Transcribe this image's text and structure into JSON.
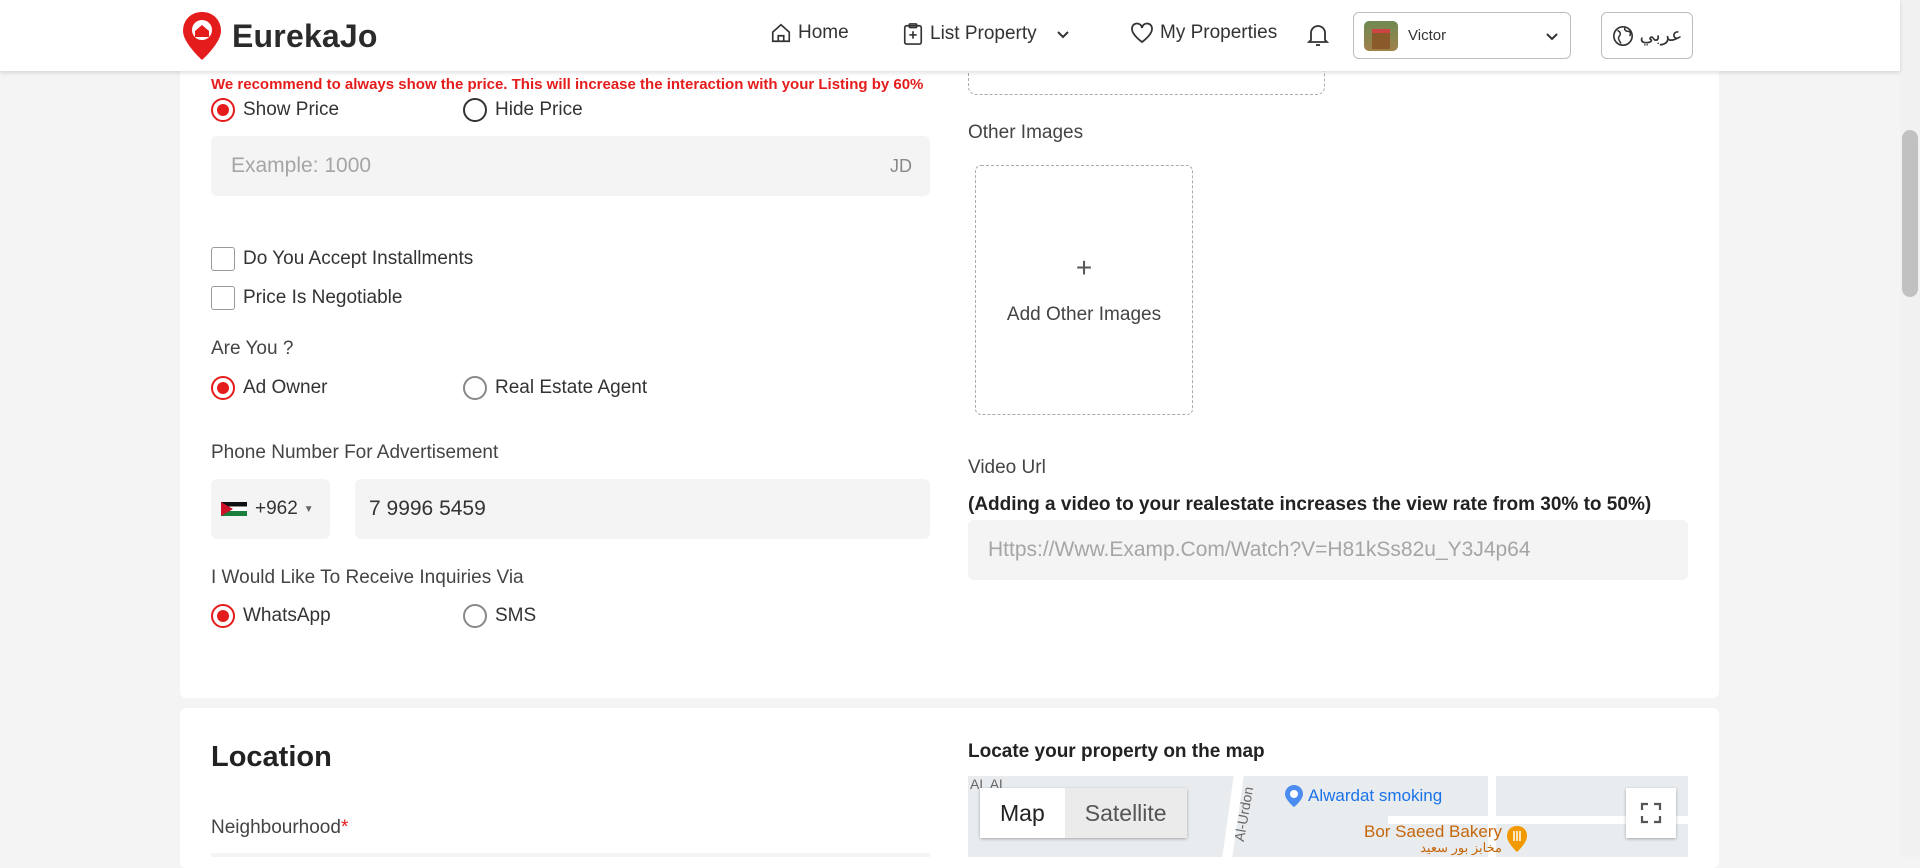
{
  "header": {
    "brand": "EurekaJo",
    "nav": {
      "home": "Home",
      "list_property": "List Property",
      "my_properties": "My Properties"
    },
    "user_name": "Victor",
    "language_button": "عربي"
  },
  "price": {
    "warning": "We recommend to always show the price. This will increase the interaction with your Listing by 60%",
    "show_price": "Show Price",
    "hide_price": "Hide Price",
    "selected": "Show Price",
    "input_placeholder": "Example: 1000",
    "currency_suffix": "JD"
  },
  "options": {
    "installments": "Do You Accept Installments",
    "negotiable": "Price Is Negotiable"
  },
  "role": {
    "label": "Are You ?",
    "ad_owner": "Ad Owner",
    "agent": "Real Estate Agent",
    "selected": "Ad Owner"
  },
  "phone": {
    "label": "Phone Number For Advertisement",
    "country_code": "+962",
    "number": "7 9996 5459"
  },
  "inquiries": {
    "label": "I Would Like To Receive Inquiries Via",
    "whatsapp": "WhatsApp",
    "sms": "SMS",
    "selected": "WhatsApp"
  },
  "media": {
    "other_images_label": "Other Images",
    "add_other_images": "Add Other Images",
    "plus": "+",
    "video_label": "Video Url",
    "video_hint": "(Adding a video to your realestate increases the view rate from 30% to 50%)",
    "video_placeholder": "Https://Www.Examp.Com/Watch?V=H81kSs82u_Y3J4p64"
  },
  "location": {
    "title": "Location",
    "neighbourhood_label": "Neighbourhood",
    "required_mark": "*",
    "map_title": "Locate your property on the map",
    "map_btn": "Map",
    "satellite_btn": "Satellite",
    "poi_1": "Alwardat smoking",
    "poi_2": "Bor Saeed Bakery",
    "poi_2_ar": "مخابز بور سعيد",
    "street_label": "Al-Urdon",
    "area_label": "AL AL"
  },
  "colors": {
    "accent": "#e41c1c",
    "input_bg": "#f4f4f4"
  }
}
